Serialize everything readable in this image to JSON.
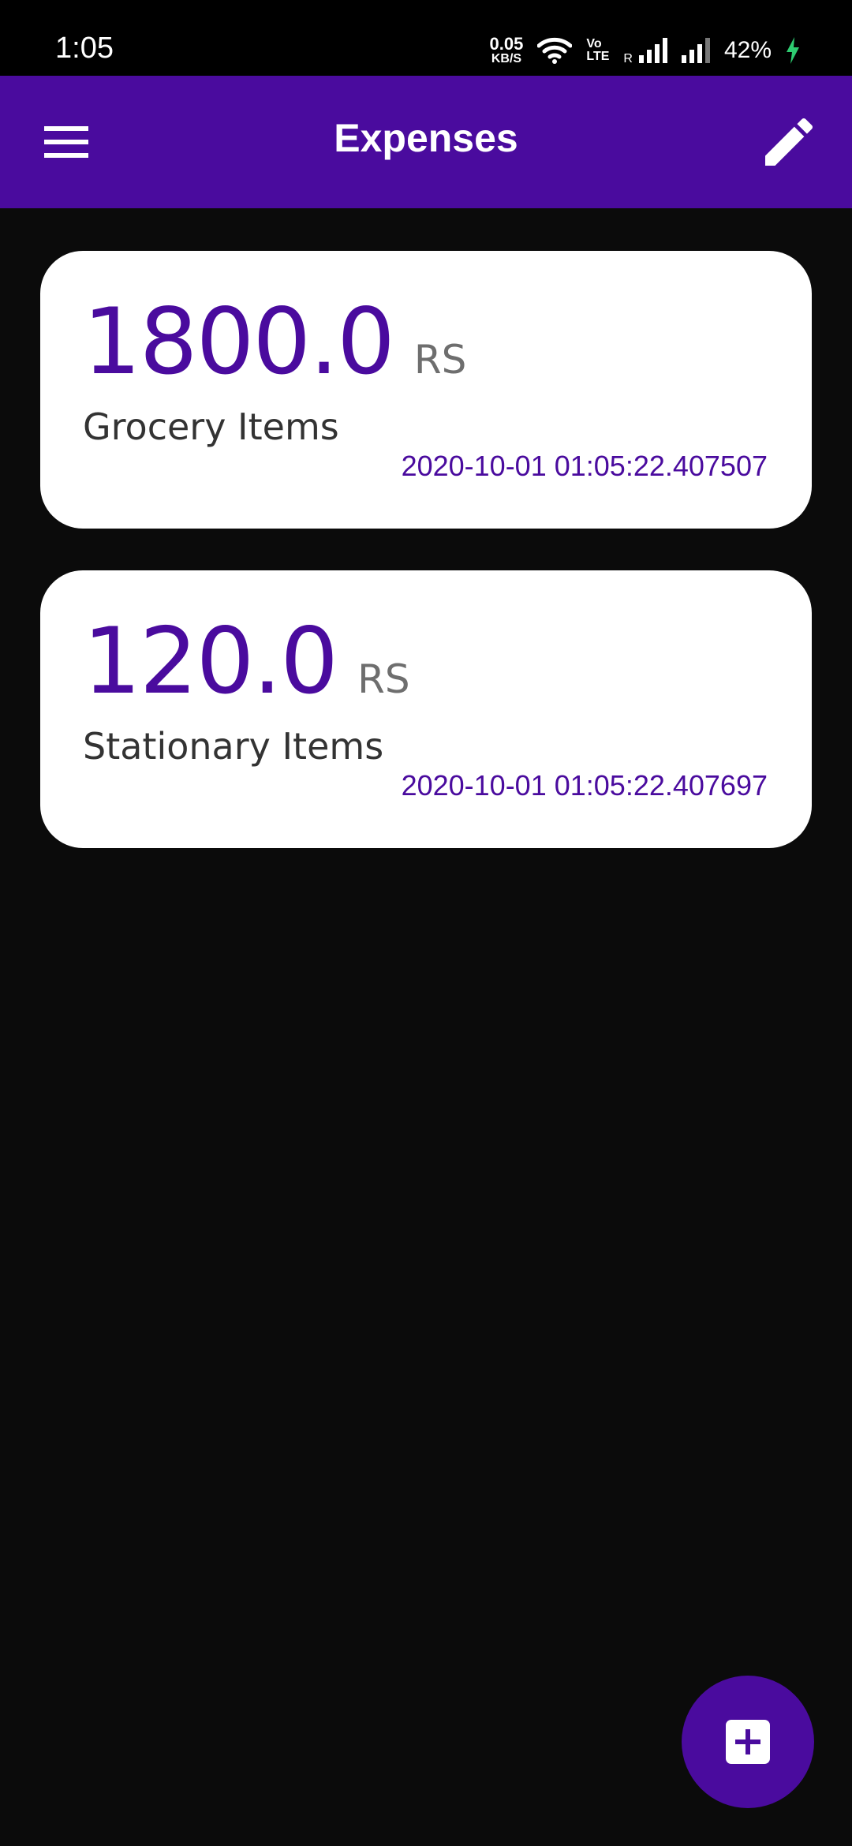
{
  "status_bar": {
    "time": "1:05",
    "net_speed_value": "0.05",
    "net_speed_unit": "KB/S",
    "volte_top": "Vo",
    "volte_bottom": "LTE",
    "roaming": "R",
    "battery": "42%",
    "icons": [
      "wifi-icon",
      "signal-icon",
      "signal-icon",
      "charging-icon"
    ]
  },
  "app_bar": {
    "title": "Expenses",
    "menu_icon": "menu-icon",
    "edit_icon": "edit-icon"
  },
  "expenses": [
    {
      "amount": "1800.0",
      "unit": "RS",
      "title": "Grocery Items",
      "date": "2020-10-01 01:05:22.407507"
    },
    {
      "amount": "120.0",
      "unit": "RS",
      "title": "Stationary Items",
      "date": "2020-10-01 01:05:22.407697"
    }
  ],
  "fab": {
    "icon": "add-box-icon"
  },
  "colors": {
    "primary": "#4a0b9e",
    "background": "#0b0b0b",
    "card": "#ffffff",
    "charging": "#2ecc71"
  }
}
